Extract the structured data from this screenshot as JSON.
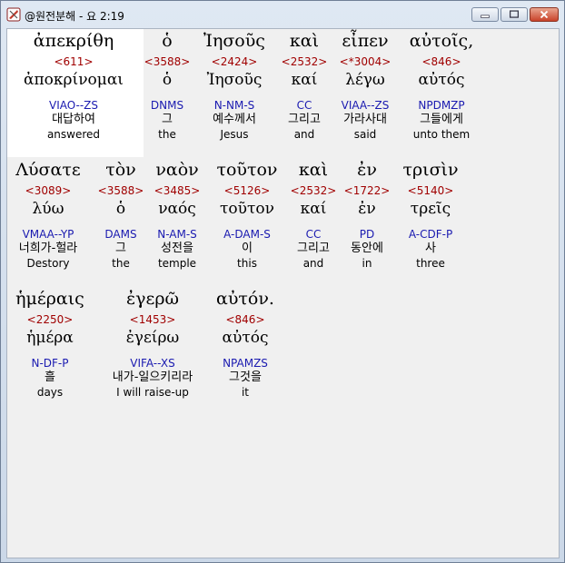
{
  "window": {
    "title": "@원전분해 - 요 2:19",
    "icon": "app-icon",
    "buttons": [
      "minimize-icon",
      "maximize-icon",
      "close-icon"
    ],
    "close_color": "#c9422a"
  },
  "colors": {
    "strongs": "#a00000",
    "parsing": "#1a1ab0",
    "text": "#000000",
    "selected_bg": "#ffffff"
  },
  "lines": [
    [
      {
        "greek": "ἀπεκρίθη",
        "strongs": "<611>",
        "lemma": "ἀποκρίνομαι",
        "parsing": "VIAO--ZS",
        "korean": "대답하여",
        "english": "answered",
        "selected": true
      },
      {
        "greek": "ὁ",
        "strongs": "<3588>",
        "lemma": "ὁ",
        "parsing": "DNMS",
        "korean": "그",
        "english": "the"
      },
      {
        "greek": "Ἰησοῦς",
        "strongs": "<2424>",
        "lemma": "Ἰησοῦς",
        "parsing": "N-NM-S",
        "korean": "예수께서",
        "english": "Jesus"
      },
      {
        "greek": "καὶ",
        "strongs": "<2532>",
        "lemma": "καί",
        "parsing": "CC",
        "korean": "그리고",
        "english": "and"
      },
      {
        "greek": "εἶπεν",
        "strongs": "<*3004>",
        "lemma": "λέγω",
        "parsing": "VIAA--ZS",
        "korean": "가라사대",
        "english": "said"
      },
      {
        "greek": "αὐτοῖς,",
        "strongs": "<846>",
        "lemma": "αὐτός",
        "parsing": "NPDMZP",
        "korean": "그들에게",
        "english": "unto them"
      }
    ],
    [
      {
        "greek": "Λύσατε",
        "strongs": "<3089>",
        "lemma": "λύω",
        "parsing": "VMAA--YP",
        "korean": "너희가-헐라",
        "english": "Destory"
      },
      {
        "greek": "τὸν",
        "strongs": "<3588>",
        "lemma": "ὁ",
        "parsing": "DAMS",
        "korean": "그",
        "english": "the"
      },
      {
        "greek": "ναὸν",
        "strongs": "<3485>",
        "lemma": "ναός",
        "parsing": "N-AM-S",
        "korean": "성전을",
        "english": "temple"
      },
      {
        "greek": "τοῦτον",
        "strongs": "<5126>",
        "lemma": "τοῦτον",
        "parsing": "A-DAM-S",
        "korean": "이",
        "english": "this"
      },
      {
        "greek": "καὶ",
        "strongs": "<2532>",
        "lemma": "καί",
        "parsing": "CC",
        "korean": "그리고",
        "english": "and"
      },
      {
        "greek": "ἐν",
        "strongs": "<1722>",
        "lemma": "ἐν",
        "parsing": "PD",
        "korean": "동안에",
        "english": "in"
      },
      {
        "greek": "τρισὶν",
        "strongs": "<5140>",
        "lemma": "τρεῖς",
        "parsing": "A-CDF-P",
        "korean": "사",
        "english": "three"
      }
    ],
    [
      {
        "greek": "ἡμέραις",
        "strongs": "<2250>",
        "lemma": "ἡμέρα",
        "parsing": "N-DF-P",
        "korean": "흘",
        "english": "days"
      },
      {
        "greek": "ἐγερῶ",
        "strongs": "<1453>",
        "lemma": "ἐγείρω",
        "parsing": "VIFA--XS",
        "korean": "내가-일으키리라",
        "english": "I will raise-up"
      },
      {
        "greek": "αὐτόν.",
        "strongs": "<846>",
        "lemma": "αὐτός",
        "parsing": "NPAMZS",
        "korean": "그것을",
        "english": "it"
      }
    ]
  ]
}
